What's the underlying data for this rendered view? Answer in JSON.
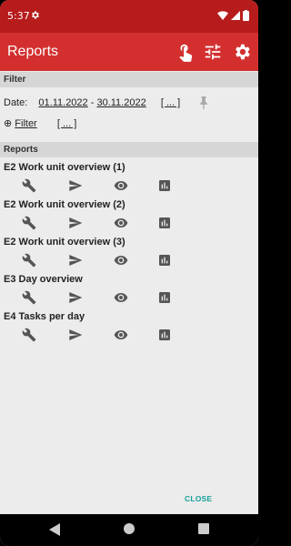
{
  "status_bar": {
    "time": "5:37"
  },
  "app_bar": {
    "title": "Reports"
  },
  "filter_section": {
    "heading": "Filter",
    "date_label": "Date:",
    "date_from": "01.11.2022",
    "date_separator": "-",
    "date_to": "30.11.2022",
    "date_more": "[ ... ]",
    "filter_symbol": "⊕",
    "filter_label": "Filter",
    "filter_more": "[ ... ]"
  },
  "reports_section": {
    "heading": "Reports",
    "items": [
      {
        "title": "E2 Work unit overview (1)"
      },
      {
        "title": "E2 Work unit overview (2)"
      },
      {
        "title": "E2 Work unit overview (3)"
      },
      {
        "title": "E3 Day overview"
      },
      {
        "title": "E4 Tasks per day"
      }
    ],
    "item_icons": [
      "wrench-icon",
      "send-icon",
      "eye-icon",
      "bar-chart-icon"
    ]
  },
  "dialog": {
    "close_label": "CLOSE"
  },
  "colors": {
    "status_bar": "#b71c1c",
    "app_bar": "#d32f2f",
    "accent": "#159f9a",
    "background": "#ececec"
  }
}
